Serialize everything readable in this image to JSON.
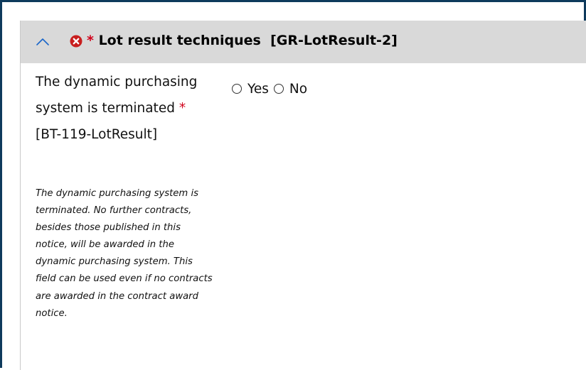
{
  "colors": {
    "frame_border": "#0e3a5c",
    "header_bg": "#d9d9d9",
    "required_star": "#d0021b",
    "error_icon": "#c81e1e",
    "collapse_icon": "#1a66c9"
  },
  "group": {
    "collapse_icon": "chevron-up-icon",
    "error_icon": "error-circle-x-icon",
    "required_marker": "*",
    "title": "Lot result techniques  [GR-LotResult-2]"
  },
  "field": {
    "label_text": "The dynamic purchasing system is terminated",
    "required_marker": "*",
    "label_code": "[BT-119-LotResult]",
    "help_text": "The dynamic purchasing system is terminated. No further contracts, besides those published in this notice, will be awarded in the dynamic purchasing system. This field can be used even if no contracts are awarded in the contract award notice.",
    "options": [
      {
        "label": "Yes",
        "selected": false
      },
      {
        "label": "No",
        "selected": false
      }
    ]
  }
}
